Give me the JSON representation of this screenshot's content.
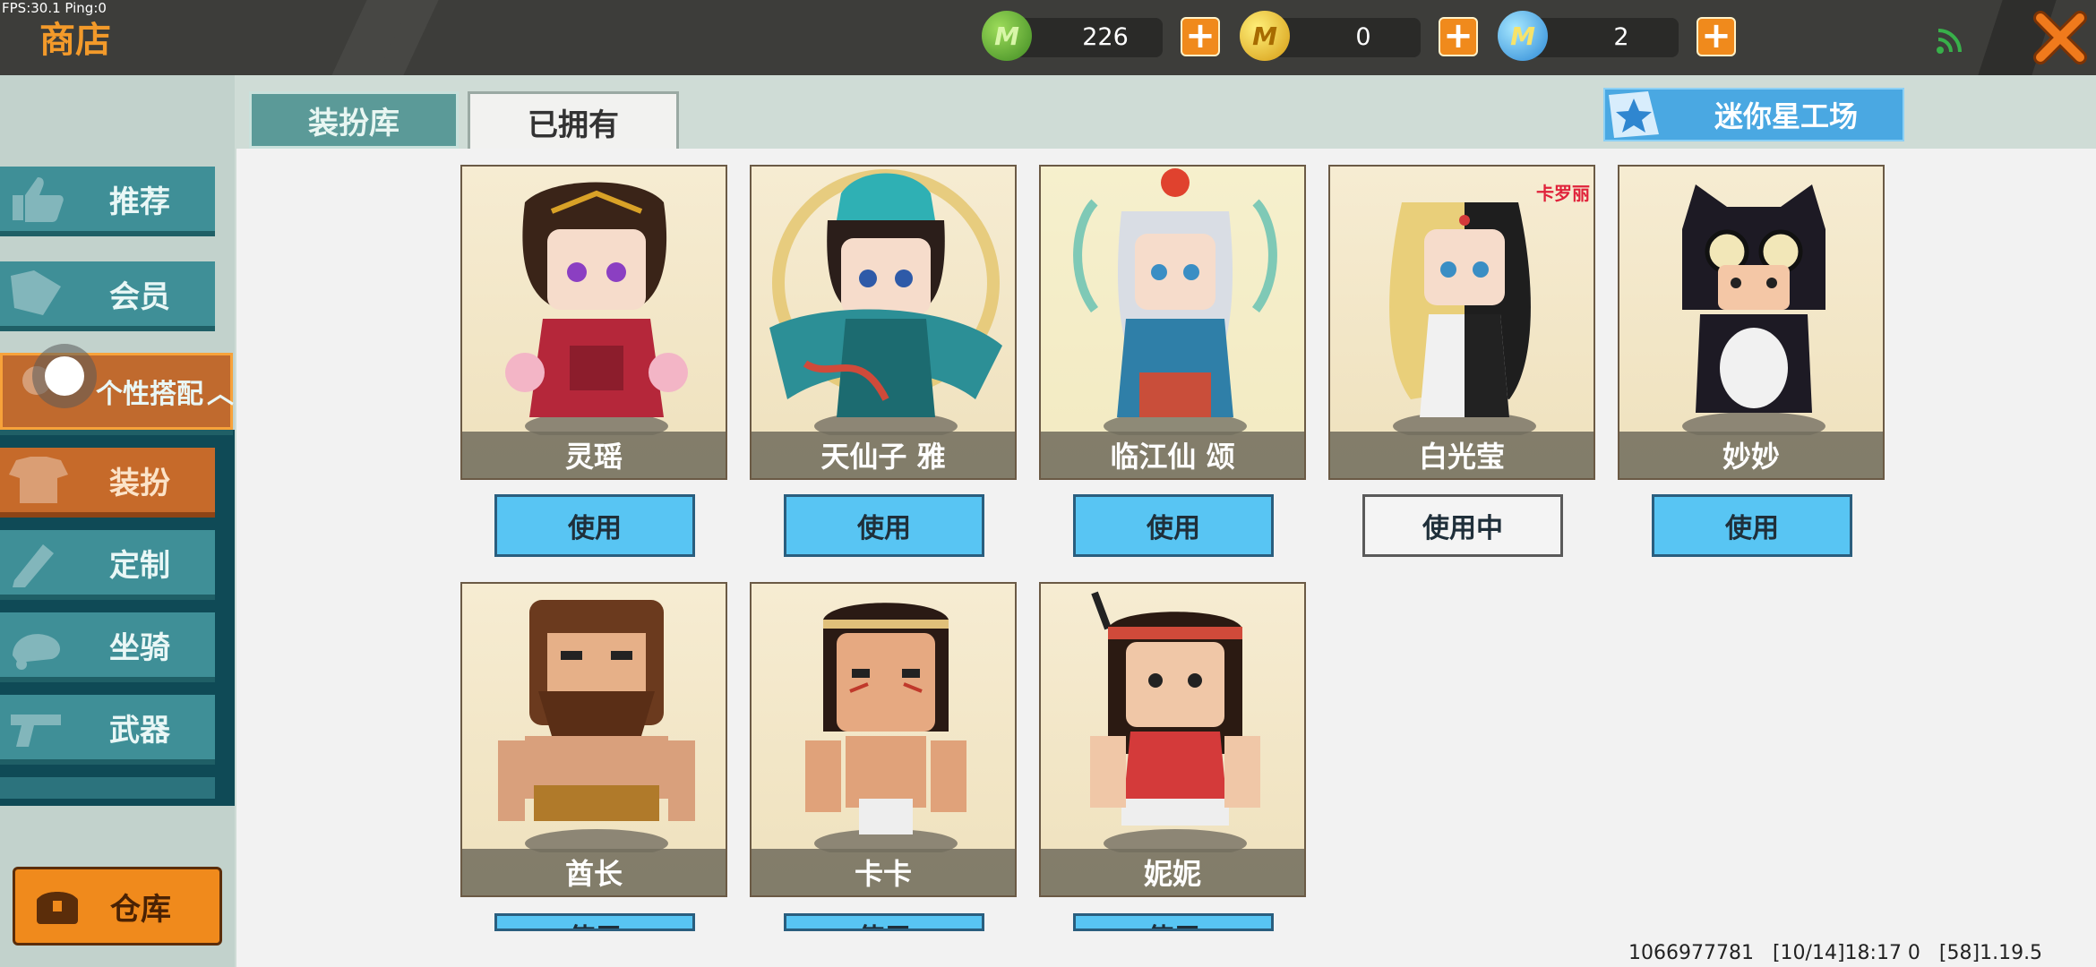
{
  "debug": {
    "fps_text": "FPS:30.1  Ping:0"
  },
  "header": {
    "title": "商店",
    "currencies": [
      {
        "name": "mini-bean",
        "symbol": "M",
        "value": "226",
        "color": "#4f9a2a"
      },
      {
        "name": "mini-coin",
        "symbol": "M",
        "value": "0",
        "color": "#e0b02a"
      },
      {
        "name": "star",
        "symbol": "M",
        "value": "2",
        "color": "#3a9fe0"
      }
    ]
  },
  "sidebar": {
    "items": [
      {
        "label": "推荐",
        "icon": "thumbs-up-icon"
      },
      {
        "label": "会员",
        "icon": "vip-icon"
      },
      {
        "label": "个性搭配",
        "icon": "outfit-icon",
        "active": true
      },
      {
        "label": "装扮",
        "icon": "shirt-icon"
      },
      {
        "label": "定制",
        "icon": "pencil-icon"
      },
      {
        "label": "坐骑",
        "icon": "mount-icon"
      },
      {
        "label": "武器",
        "icon": "gun-icon"
      }
    ],
    "warehouse_label": "仓库"
  },
  "tabs": [
    {
      "label": "装扮库",
      "selected": false
    },
    {
      "label": "已拥有",
      "selected": true
    }
  ],
  "workshop_label": "迷你星工场",
  "skins": [
    {
      "name": "灵瑶",
      "button": "使用",
      "in_use": false,
      "badge": ""
    },
    {
      "name": "天仙子 雅",
      "button": "使用",
      "in_use": false,
      "badge": ""
    },
    {
      "name": "临江仙 颂",
      "button": "使用",
      "in_use": false,
      "badge": ""
    },
    {
      "name": "白光莹",
      "button": "使用中",
      "in_use": true,
      "badge": "卡罗丽"
    },
    {
      "name": "妙妙",
      "button": "使用",
      "in_use": false,
      "badge": ""
    },
    {
      "name": "酋长",
      "button": "使用",
      "in_use": false,
      "badge": ""
    },
    {
      "name": "卡卡",
      "button": "使用",
      "in_use": false,
      "badge": ""
    },
    {
      "name": "妮妮",
      "button": "使用",
      "in_use": false,
      "badge": ""
    }
  ],
  "footer": {
    "uid": "1066977781",
    "time": "[10/14]18:17 0",
    "version": "[58]1.19.5"
  }
}
